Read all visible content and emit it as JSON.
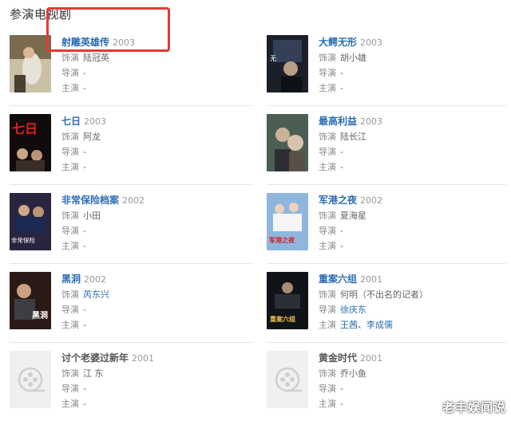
{
  "section_title": "参演电视剧",
  "labels": {
    "role": "饰演",
    "director": "导演",
    "lead": "主演"
  },
  "items": [
    {
      "title": "射雕英雄传",
      "year": "2003",
      "role": "陆冠英",
      "director": "-",
      "lead": "-",
      "title_link": true,
      "role_link": false,
      "lead_link": false
    },
    {
      "title": "大鳄无形",
      "year": "2003",
      "role": "胡小雄",
      "director": "-",
      "lead": "-",
      "title_link": true,
      "role_link": false,
      "lead_link": false
    },
    {
      "title": "七日",
      "year": "2003",
      "role": "阿龙",
      "director": "-",
      "lead": "-",
      "title_link": true,
      "role_link": false,
      "lead_link": false
    },
    {
      "title": "最高利益",
      "year": "2003",
      "role": "陆长江",
      "director": "-",
      "lead": "-",
      "title_link": true,
      "role_link": false,
      "lead_link": false
    },
    {
      "title": "非常保险档案",
      "year": "2002",
      "role": "小田",
      "director": "-",
      "lead": "-",
      "title_link": true,
      "role_link": false,
      "lead_link": false
    },
    {
      "title": "军港之夜",
      "year": "2002",
      "role": "夏海星",
      "director": "-",
      "lead": "-",
      "title_link": true,
      "role_link": false,
      "lead_link": false
    },
    {
      "title": "黑洞",
      "year": "2002",
      "role": "芮东兴",
      "director": "-",
      "lead": "-",
      "title_link": true,
      "role_link": true,
      "lead_link": false
    },
    {
      "title": "重案六组",
      "year": "2001",
      "role": "何明（不出名的记者）",
      "director": "徐庆东",
      "lead": "王茜、李成儒",
      "title_link": true,
      "role_link": false,
      "lead_link": true
    },
    {
      "title": "讨个老婆过新年",
      "year": "2001",
      "role": "江 东",
      "director": "-",
      "lead": "-",
      "title_link": false,
      "role_link": false,
      "lead_link": false
    },
    {
      "title": "黄金时代",
      "year": "2001",
      "role": "乔小鱼",
      "director": "-",
      "lead": "-",
      "title_link": false,
      "role_link": false,
      "lead_link": false
    }
  ],
  "poster_text": {
    "p3": "七日",
    "p5": "非常保险",
    "p6": "军港之夜",
    "p7": "黑洞",
    "p8": "重案六组"
  },
  "watermark": "老丰娱闻说",
  "colors": {
    "link": "#2a6cb1",
    "highlight": "#e53935",
    "divider": "#e6e6e6"
  }
}
